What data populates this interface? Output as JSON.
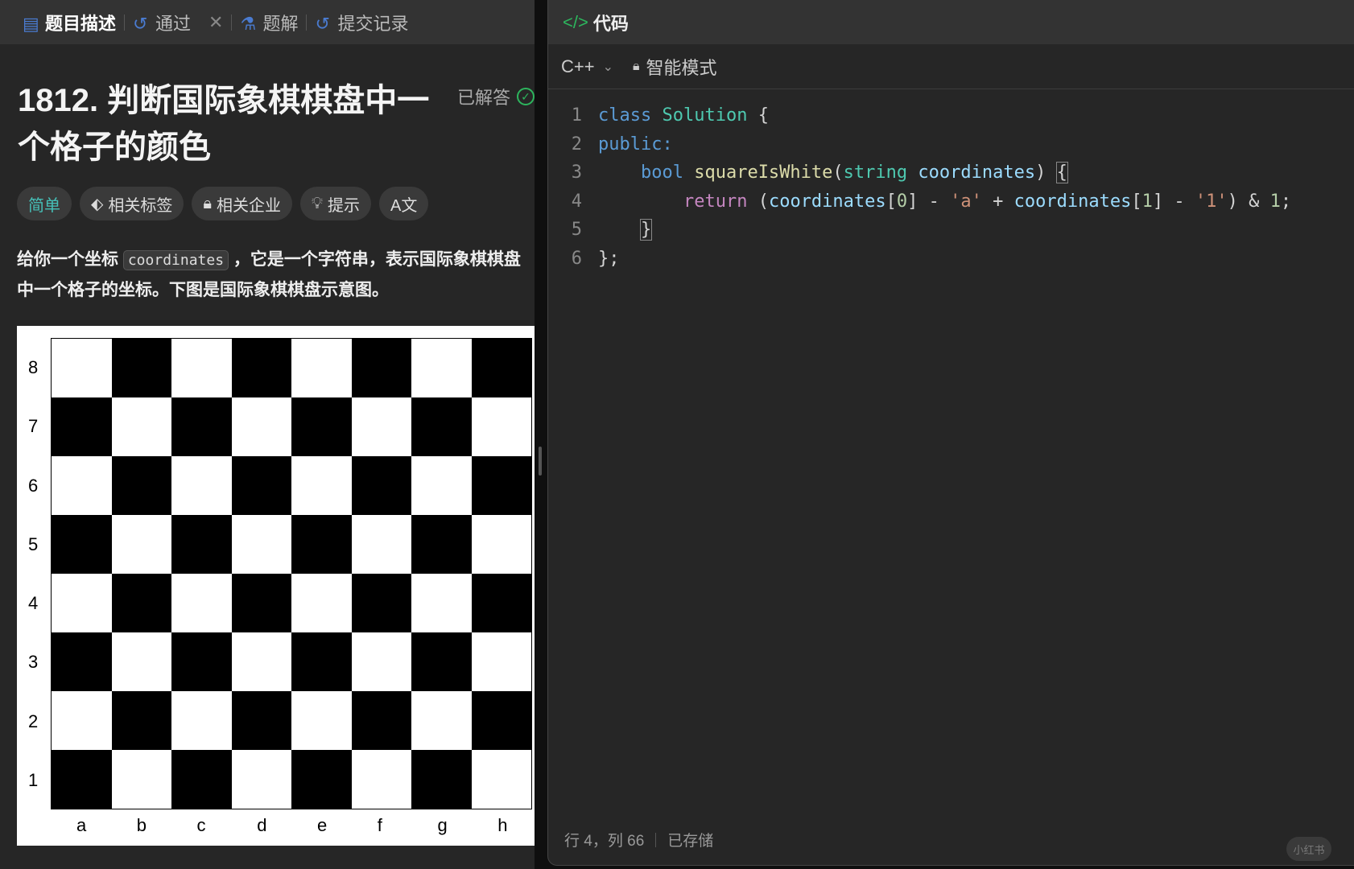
{
  "left_tabs": [
    {
      "label": "题目描述",
      "icon": "document-icon"
    },
    {
      "label": "通过",
      "icon": "history-icon",
      "close": "✕"
    },
    {
      "label": "题解",
      "icon": "flask-icon"
    },
    {
      "label": "提交记录",
      "icon": "history-icon"
    }
  ],
  "problem": {
    "title": "1812. 判断国际象棋棋盘中一个格子的颜色",
    "status": "已解答",
    "tags": [
      "简单",
      "相关标签",
      "相关企业",
      "提示",
      "A文"
    ],
    "desc_before": "给你一个坐标 ",
    "desc_code": "coordinates",
    "desc_after": " ，它是一个字符串，表示国际象棋棋盘中一个格子的坐标。下图是国际象棋棋盘示意图。"
  },
  "board": {
    "ranks": [
      "8",
      "7",
      "6",
      "5",
      "4",
      "3",
      "2",
      "1"
    ],
    "files": [
      "a",
      "b",
      "c",
      "d",
      "e",
      "f",
      "g",
      "h"
    ]
  },
  "editor": {
    "panel_title": "代码",
    "language": "C++",
    "mode": "智能模式",
    "line_numbers": [
      "1",
      "2",
      "3",
      "4",
      "5",
      "6"
    ],
    "status_position": "行 4，列 66",
    "status_saved": "已存储"
  },
  "watermark": "小红书",
  "colors": {
    "easy": "#46c0b8",
    "accent": "#4a7bd0",
    "solved": "#2db55d"
  }
}
